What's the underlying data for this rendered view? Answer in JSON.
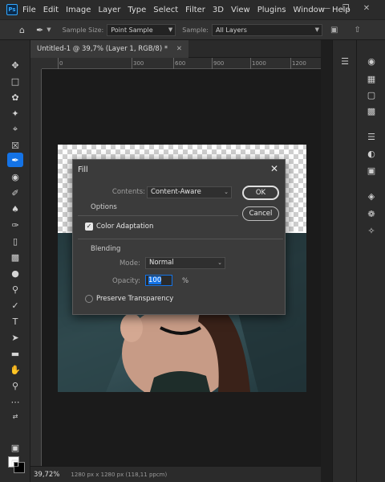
{
  "app": {
    "logo": "Ps",
    "menu": [
      "File",
      "Edit",
      "Image",
      "Layer",
      "Type",
      "Select",
      "Filter",
      "3D",
      "View",
      "Plugins",
      "Window",
      "Help"
    ]
  },
  "options_bar": {
    "sample_size_label": "Sample Size:",
    "sample_size_value": "Point Sample",
    "sample_label": "Sample:",
    "sample_value": "All Layers"
  },
  "document": {
    "tab_title": "Untitled-1 @ 39,7% (Layer 1, RGB/8) *",
    "ruler_ticks": [
      "0",
      "300",
      "600",
      "900",
      "1000",
      "1200"
    ],
    "zoom": "39,72%",
    "info": "1280 px x 1280 px (118,11 ppcm)"
  },
  "fill_dialog": {
    "title": "Fill",
    "contents_label": "Contents:",
    "contents_value": "Content-Aware",
    "options_label": "Options",
    "color_adaptation_label": "Color Adaptation",
    "color_adaptation_checked": true,
    "blending_label": "Blending",
    "mode_label": "Mode:",
    "mode_value": "Normal",
    "opacity_label": "Opacity:",
    "opacity_value": "100",
    "opacity_unit": "%",
    "preserve_transparency_label": "Preserve Transparency",
    "preserve_transparency_checked": false,
    "ok_label": "OK",
    "cancel_label": "Cancel"
  },
  "colors": {
    "accent": "#1473e6",
    "foreground": "#ffffff",
    "background": "#000000"
  }
}
